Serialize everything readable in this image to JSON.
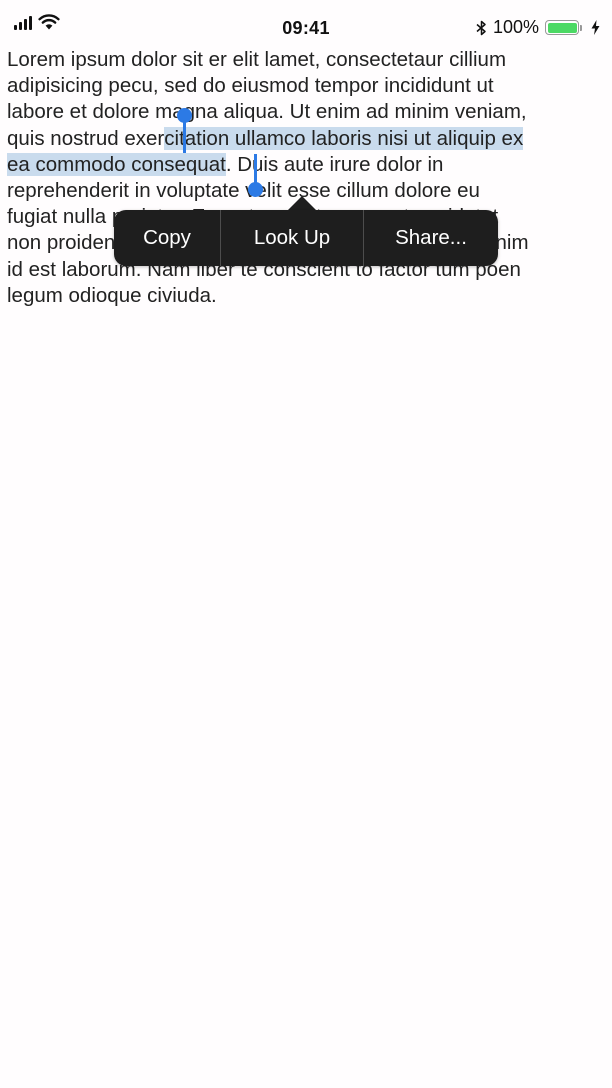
{
  "status_bar": {
    "time": "09:41",
    "battery_percent": "100%",
    "battery_level": 1.0,
    "battery_color": "#4cd964",
    "icons": [
      "signal-icon",
      "wifi-icon",
      "bluetooth-icon",
      "battery-icon",
      "charging-bolt-icon"
    ]
  },
  "document": {
    "lines": [
      {
        "before": "Lorem ipsum dolor sit er elit lamet, consectetaur cillium",
        "selected": "",
        "after": ""
      },
      {
        "before": "adipisicing pecu, sed do eiusmod tempor incididunt ut",
        "selected": "",
        "after": ""
      },
      {
        "before": "labore et dolore magna aliqua. Ut enim ad minim veniam,",
        "selected": "",
        "after": ""
      },
      {
        "before": "quis nostrud exer",
        "selected": "citation ullamco laboris nisi ut aliquip ex",
        "after": ""
      },
      {
        "before": "",
        "selected": "ea commodo consequat",
        "after": ". Duis aute irure dolor in"
      },
      {
        "before": "reprehenderit in voluptate velit esse cillum dolore eu",
        "selected": "",
        "after": ""
      },
      {
        "before": "fugiat nulla pariatur. Excepteur sint occaecat cupidatat",
        "selected": "",
        "after": ""
      },
      {
        "before": "non proident, sunt in culpa qui officia deserunt mollit anim",
        "selected": "",
        "after": ""
      },
      {
        "before": "id est laborum. Nam liber te conscient to factor tum poen",
        "selected": "",
        "after": ""
      },
      {
        "before": "legum odioque civiuda.",
        "selected": "",
        "after": ""
      }
    ],
    "selection_color": "#c9dbed",
    "handle_color": "#2c7ae5"
  },
  "context_menu": {
    "items": [
      {
        "label": "Copy"
      },
      {
        "label": "Look Up"
      },
      {
        "label": "Share..."
      }
    ],
    "background_color": "#1e1e1e"
  }
}
